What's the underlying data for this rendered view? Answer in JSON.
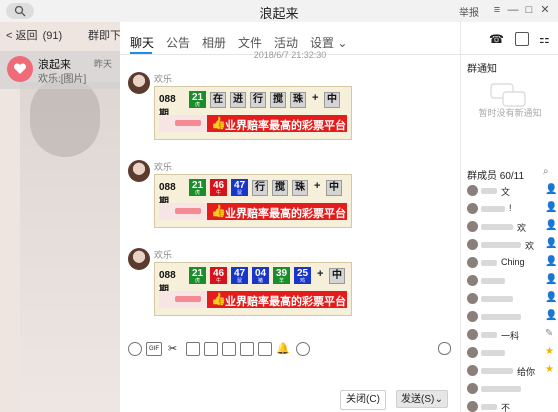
{
  "window": {
    "title": "浪起来",
    "report_label": "举报"
  },
  "sidebar": {
    "back_label": "返回",
    "unread": "(91)",
    "more_label": "群即下",
    "chat": {
      "name": "浪起来",
      "preview": "欢乐:[图片]",
      "time": "昨天"
    }
  },
  "tabs": [
    "聊天",
    "公告",
    "相册",
    "文件",
    "活动",
    "设置"
  ],
  "timestamp": "2018/6/7 21:32:30",
  "messages": [
    {
      "sender": "欢乐",
      "period": "088期",
      "balls": [
        {
          "n": "21",
          "c": "g",
          "s": "虎"
        }
      ],
      "tags": [
        "在",
        "进",
        "行",
        "搅",
        "珠"
      ],
      "tail": "中",
      "banner": "业界赔率最高的彩票平台"
    },
    {
      "sender": "欢乐",
      "period": "088期",
      "balls": [
        {
          "n": "21",
          "c": "g",
          "s": "虎"
        },
        {
          "n": "46",
          "c": "r",
          "s": "牛"
        },
        {
          "n": "47",
          "c": "b",
          "s": "鼠"
        }
      ],
      "tags": [
        "行",
        "搅",
        "珠"
      ],
      "tail": "中",
      "banner": "业界赔率最高的彩票平台"
    },
    {
      "sender": "欢乐",
      "period": "088期",
      "balls": [
        {
          "n": "21",
          "c": "g",
          "s": "虎"
        },
        {
          "n": "46",
          "c": "r",
          "s": "牛"
        },
        {
          "n": "47",
          "c": "b",
          "s": "鼠"
        },
        {
          "n": "04",
          "c": "b",
          "s": "猪"
        },
        {
          "n": "39",
          "c": "g",
          "s": "羊"
        },
        {
          "n": "25",
          "c": "b",
          "s": "鸡"
        }
      ],
      "tags": [],
      "tail": "中",
      "banner": "业界赔率最高的彩票平台"
    }
  ],
  "composer": {
    "close_label": "关闭(C)",
    "send_label": "发送(S)"
  },
  "right_panel": {
    "notice_title": "群通知",
    "notice_empty": "暂时没有新通知",
    "members_title": "群成员 60/11",
    "members": [
      {
        "name": "文",
        "role": "owner"
      },
      {
        "name": "!",
        "role": "admin"
      },
      {
        "name": "欢",
        "role": "admin"
      },
      {
        "name": "欢",
        "role": "admin"
      },
      {
        "name": "Ching",
        "role": "admin"
      },
      {
        "name": "",
        "role": "admin"
      },
      {
        "name": "",
        "role": "admin"
      },
      {
        "name": "",
        "role": "admin"
      },
      {
        "name": "一科",
        "role": "edit"
      },
      {
        "name": "",
        "role": "star"
      },
      {
        "name": "给你",
        "role": "star"
      },
      {
        "name": "",
        "role": "none"
      },
      {
        "name": "不",
        "role": "none"
      }
    ]
  }
}
